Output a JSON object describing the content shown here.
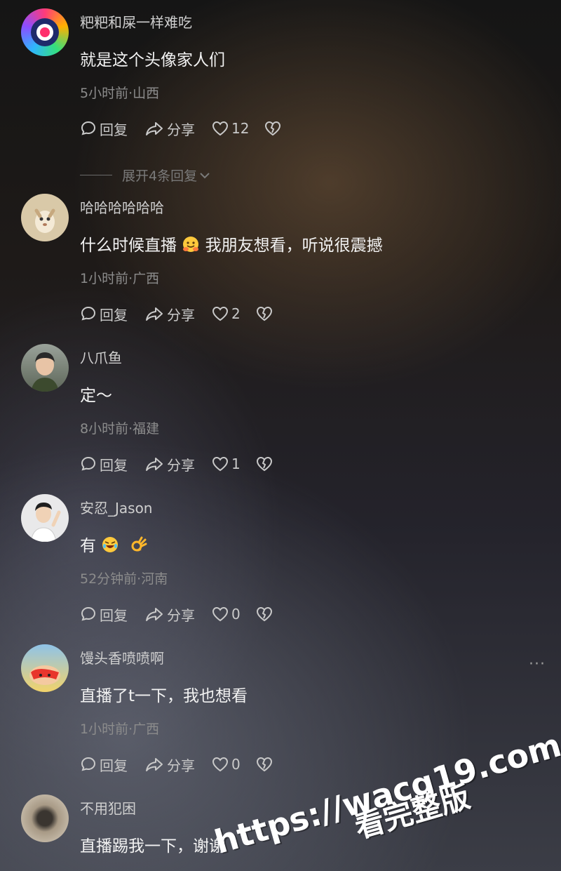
{
  "comments": [
    {
      "username": "粑粑和屎一样难吃",
      "text": "就是这个头像家人们",
      "meta": "5小时前·山西",
      "reply_label": "回复",
      "share_label": "分享",
      "likes": "12",
      "expand_label": "展开4条回复"
    },
    {
      "username": "哈哈哈哈哈哈",
      "text_before": "什么时候直播",
      "emoji": "hugging-face-icon",
      "text_after": "我朋友想看，听说很震撼",
      "meta": "1小时前·广西",
      "reply_label": "回复",
      "share_label": "分享",
      "likes": "2"
    },
    {
      "username": "八爪鱼",
      "text": "定～",
      "meta": "8小时前·福建",
      "reply_label": "回复",
      "share_label": "分享",
      "likes": "1"
    },
    {
      "username": "安忍_Jason",
      "text_before": "有",
      "emoji": [
        "rolling-laughing-icon",
        "ok-hand-icon"
      ],
      "meta": "52分钟前·河南",
      "reply_label": "回复",
      "share_label": "分享",
      "likes": "0"
    },
    {
      "username": "馒头香喷喷啊",
      "text": "直播了t一下，我也想看",
      "meta": "1小时前·广西",
      "reply_label": "回复",
      "share_label": "分享",
      "likes": "0",
      "more_label": "···"
    },
    {
      "username": "不用犯困",
      "text": "直播踢我一下，谢谢"
    }
  ],
  "watermark": {
    "line1": "https://wacg19.com",
    "line2": "看完整版"
  },
  "colors": {
    "text_primary": "#f2f2f2",
    "text_secondary": "#8c8c8c",
    "icon": "#c9c9c9"
  }
}
